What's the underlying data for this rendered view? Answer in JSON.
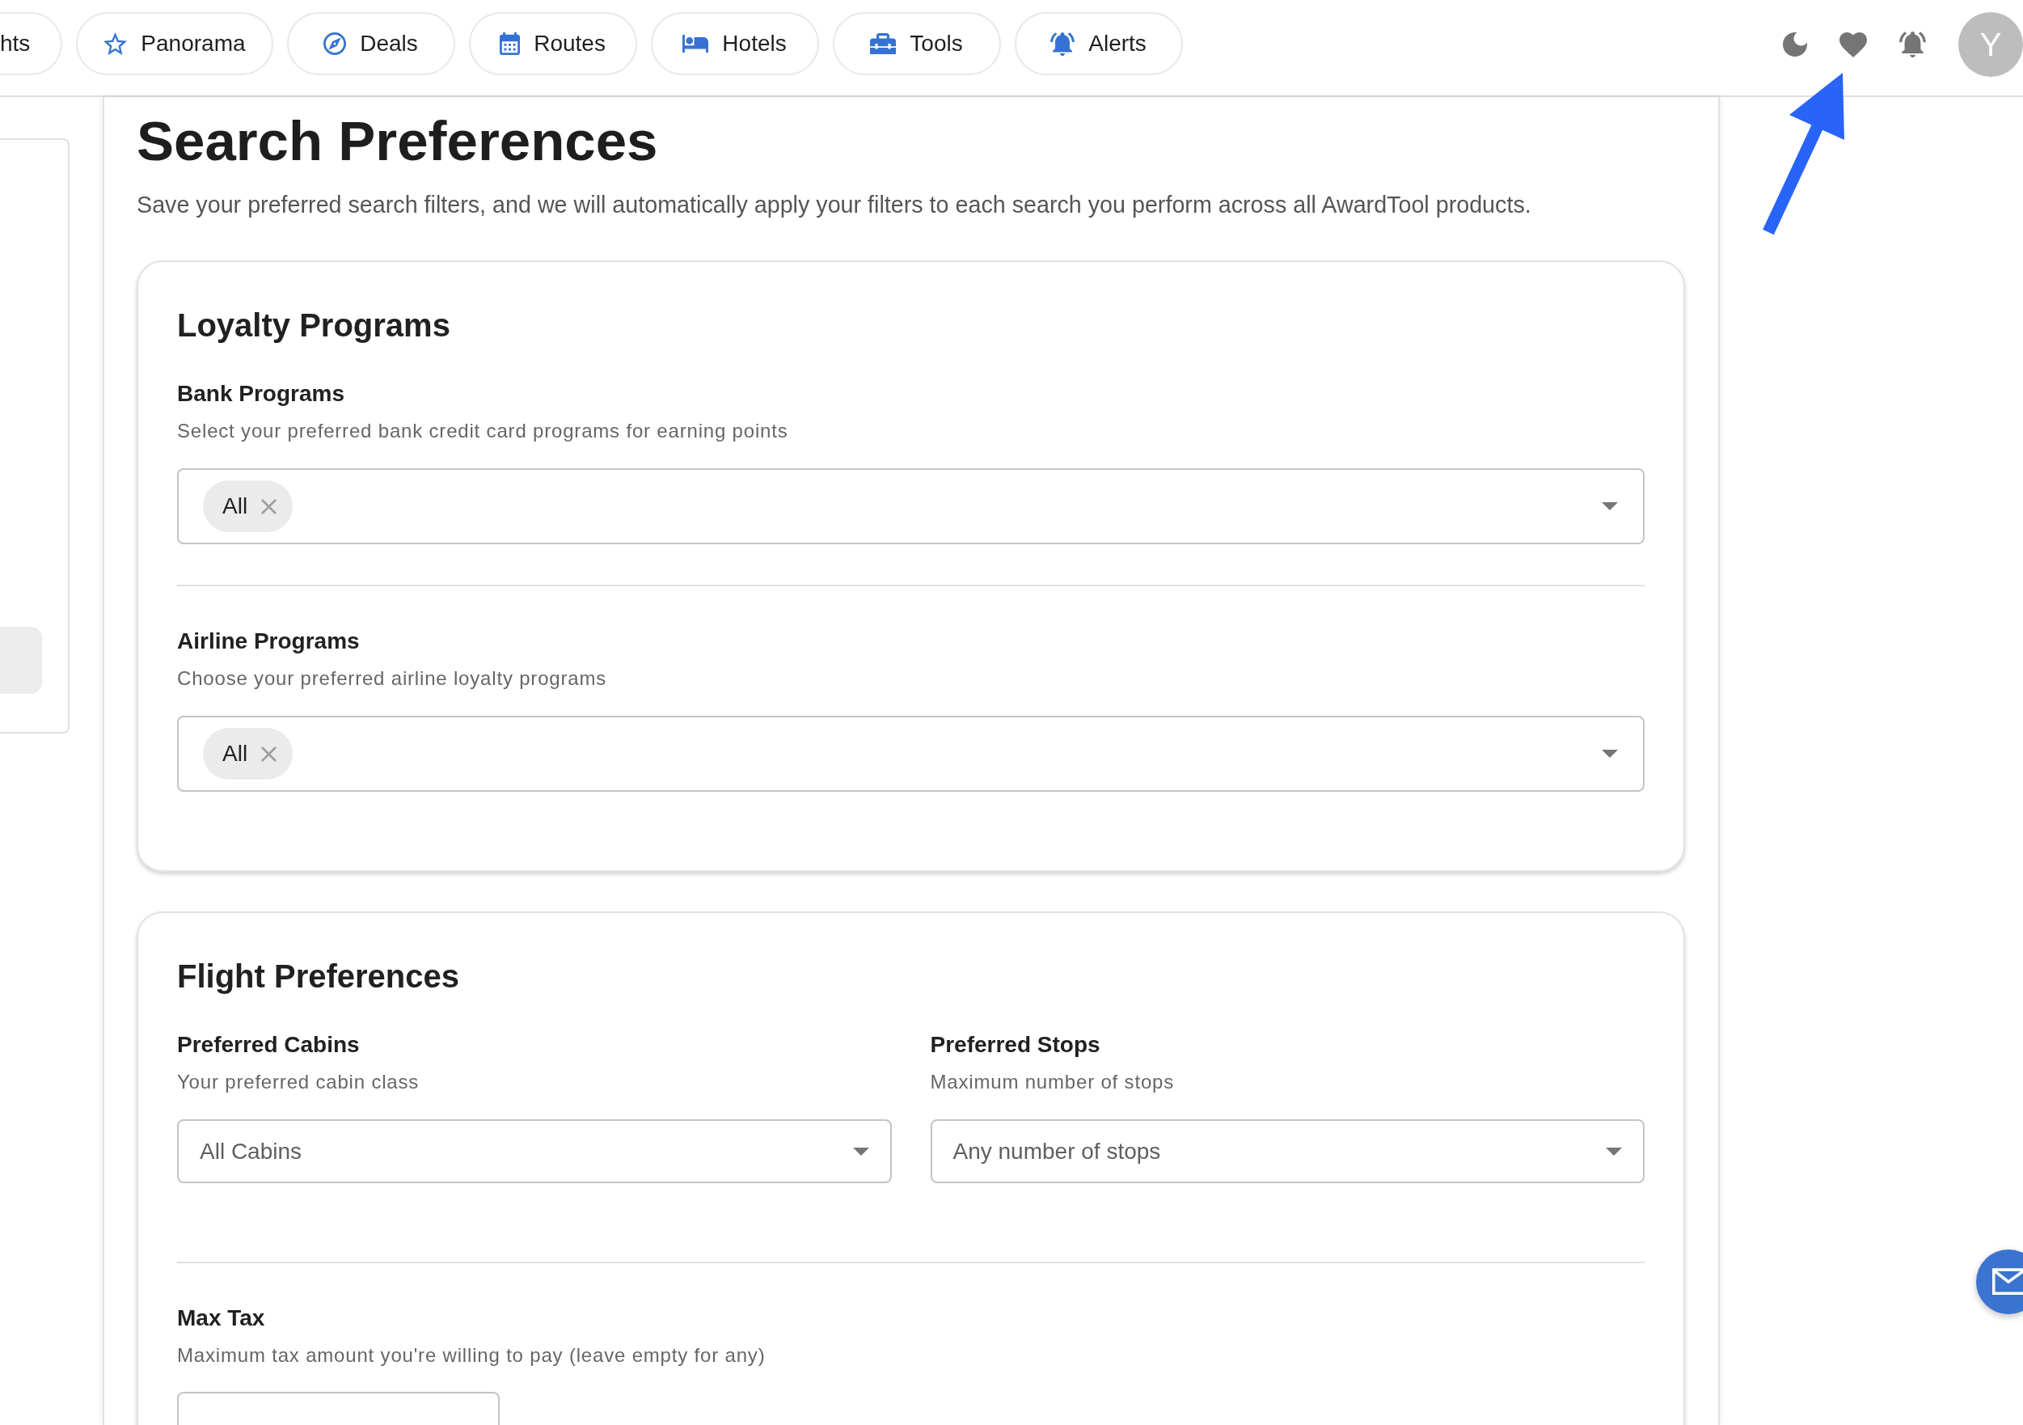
{
  "nav": {
    "tabs": [
      {
        "label": "hts"
      },
      {
        "label": "Panorama"
      },
      {
        "label": "Deals"
      },
      {
        "label": "Routes"
      },
      {
        "label": "Hotels"
      },
      {
        "label": "Tools"
      },
      {
        "label": "Alerts"
      }
    ]
  },
  "account": {
    "avatar_initial": "Y"
  },
  "annotation": {
    "kind": "arrow"
  },
  "page": {
    "title": "Search Preferences",
    "subtitle": "Save your preferred search filters, and we will automatically apply your filters to each search you perform across all AwardTool products."
  },
  "sections": [
    {
      "title": "Loyalty Programs",
      "groups": [
        {
          "fields": [
            {
              "kind": "multiselect",
              "label": "Bank Programs",
              "description": "Select your preferred bank credit card programs for earning points",
              "chips": [
                "All"
              ]
            }
          ]
        },
        {
          "fields": [
            {
              "kind": "multiselect",
              "label": "Airline Programs",
              "description": "Choose your preferred airline loyalty programs",
              "chips": [
                "All"
              ]
            }
          ]
        }
      ]
    },
    {
      "title": "Flight Preferences",
      "groups": [
        {
          "fields": [
            {
              "kind": "select",
              "label": "Preferred Cabins",
              "description": "Your preferred cabin class",
              "value": "All Cabins"
            },
            {
              "kind": "select",
              "label": "Preferred Stops",
              "description": "Maximum number of stops",
              "value": "Any number of stops"
            }
          ]
        },
        {
          "fields": [
            {
              "kind": "input",
              "label": "Max Tax",
              "description": "Maximum tax amount you're willing to pay (leave empty for any)"
            }
          ]
        }
      ]
    }
  ]
}
